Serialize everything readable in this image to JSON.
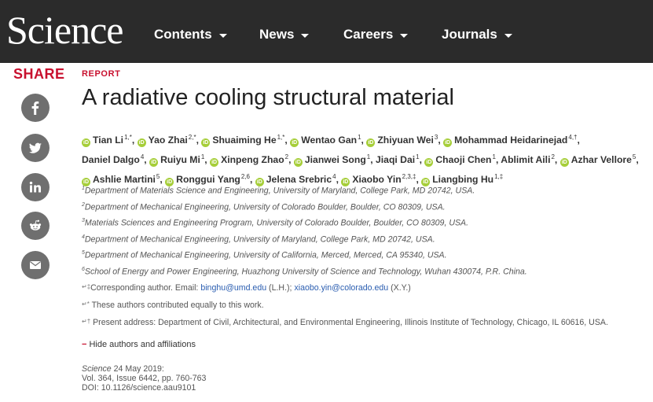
{
  "header": {
    "logo": "Science",
    "nav": [
      "Contents",
      "News",
      "Careers",
      "Journals"
    ]
  },
  "share": {
    "label": "SHARE",
    "icons": [
      "facebook-icon",
      "twitter-icon",
      "linkedin-icon",
      "reddit-icon",
      "email-icon"
    ]
  },
  "article": {
    "kicker": "REPORT",
    "title": "A radiative cooling structural material",
    "authors": [
      {
        "name": "Tian Li",
        "sup": "1,*",
        "orcid": true
      },
      {
        "name": "Yao Zhai",
        "sup": "2,*",
        "orcid": true
      },
      {
        "name": "Shuaiming He",
        "sup": "1,*",
        "orcid": true
      },
      {
        "name": "Wentao Gan",
        "sup": "1",
        "orcid": true
      },
      {
        "name": "Zhiyuan Wei",
        "sup": "3",
        "orcid": true
      },
      {
        "name": "Mohammad Heidarinejad",
        "sup": "4,†",
        "orcid": true
      },
      {
        "name": "Daniel Dalgo",
        "sup": "4",
        "orcid": false
      },
      {
        "name": "Ruiyu Mi",
        "sup": "1",
        "orcid": true
      },
      {
        "name": "Xinpeng Zhao",
        "sup": "2",
        "orcid": true
      },
      {
        "name": "Jianwei Song",
        "sup": "1",
        "orcid": true
      },
      {
        "name": "Jiaqi Dai",
        "sup": "1",
        "orcid": false
      },
      {
        "name": "Chaoji Chen",
        "sup": "1",
        "orcid": true
      },
      {
        "name": "Ablimit Aili",
        "sup": "2",
        "orcid": false
      },
      {
        "name": "Azhar Vellore",
        "sup": "5",
        "orcid": true
      },
      {
        "name": "Ashlie Martini",
        "sup": "5",
        "orcid": true
      },
      {
        "name": "Ronggui Yang",
        "sup": "2,6",
        "orcid": true
      },
      {
        "name": "Jelena Srebric",
        "sup": "4",
        "orcid": true
      },
      {
        "name": "Xiaobo Yin",
        "sup": "2,3,‡",
        "orcid": true
      },
      {
        "name": "Liangbing Hu",
        "sup": "1,‡",
        "orcid": true
      }
    ],
    "affiliations": [
      {
        "num": "1",
        "text": "Department of Materials Science and Engineering, University of Maryland, College Park, MD 20742, USA."
      },
      {
        "num": "2",
        "text": "Department of Mechanical Engineering, University of Colorado Boulder, Boulder, CO 80309, USA."
      },
      {
        "num": "3",
        "text": "Materials Sciences and Engineering Program, University of Colorado Boulder, Boulder, CO 80309, USA."
      },
      {
        "num": "4",
        "text": "Department of Mechanical Engineering, University of Maryland, College Park, MD 20742, USA."
      },
      {
        "num": "5",
        "text": "Department of Mechanical Engineering, University of California, Merced, Merced, CA 95340, USA."
      },
      {
        "num": "6",
        "text": "School of Energy and Power Engineering, Huazhong University of Science and Technology, Wuhan 430074, P.R. China."
      }
    ],
    "corresponding": {
      "marker": "↵‡",
      "prefix": "Corresponding author. Email: ",
      "email1": "binghu@umd.edu",
      "mid": " (L.H.); ",
      "email2": "xiaobo.yin@colorado.edu",
      "suffix": " (X.Y.)"
    },
    "equal": {
      "marker": "↵*",
      "text": " These authors contributed equally to this work."
    },
    "present": {
      "marker": "↵†",
      "text": " Present address: Department of Civil, Architectural, and Environmental Engineering, Illinois Institute of Technology, Chicago, IL 60616, USA."
    },
    "hide_link": "Hide authors and affiliations",
    "citation": {
      "journal": "Science",
      "date": " 24 May 2019:",
      "volume": "Vol. 364, Issue 6442, pp. 760-763",
      "doi": "DOI: 10.1126/science.aau9101"
    }
  }
}
